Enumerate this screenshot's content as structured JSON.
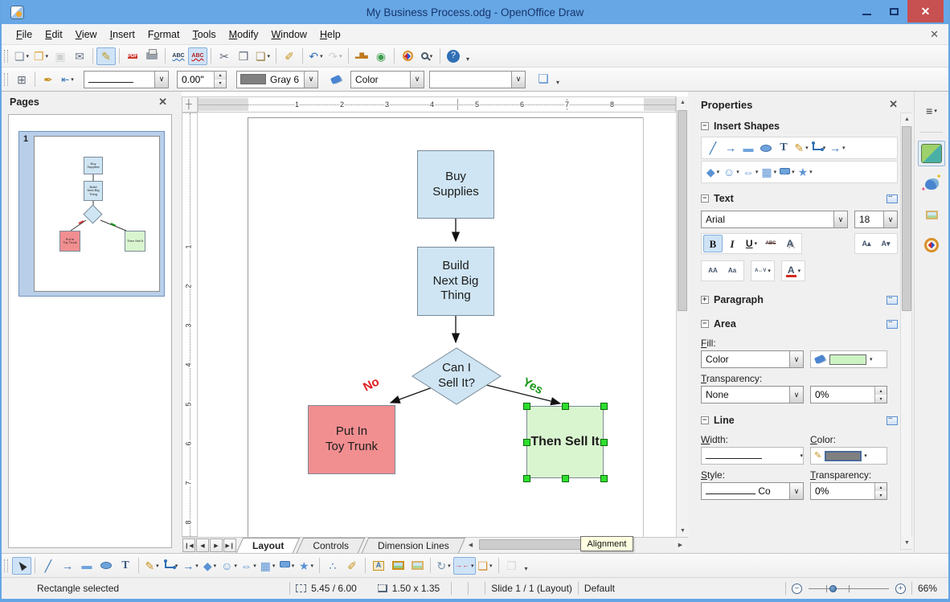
{
  "window": {
    "title": "My Business Process.odg - OpenOffice Draw"
  },
  "colors": {
    "titlebar": "#67a7e6",
    "close_button": "#c75050",
    "shape_blue": "#cfe5f3",
    "shape_red": "#f18e90",
    "shape_green": "#d9f5cf",
    "selection_handle": "#2ede2e",
    "no_label": "#e02020",
    "yes_label": "#169416",
    "line_gray": "#808080",
    "fill_green_swatch": "#cdf3c4"
  },
  "menu": {
    "items": [
      {
        "label": "File",
        "accel": 0
      },
      {
        "label": "Edit",
        "accel": 0
      },
      {
        "label": "View",
        "accel": 0
      },
      {
        "label": "Insert",
        "accel": 0
      },
      {
        "label": "Format",
        "accel": 1
      },
      {
        "label": "Tools",
        "accel": 0
      },
      {
        "label": "Modify",
        "accel": 0
      },
      {
        "label": "Window",
        "accel": 0
      },
      {
        "label": "Help",
        "accel": 0
      }
    ]
  },
  "toolbar_standard": {
    "items": [
      {
        "t": "grip"
      },
      {
        "n": "new-document-button",
        "g": "❏",
        "c": "#7d8ba0",
        "dd": true
      },
      {
        "n": "open-button",
        "g": "❐",
        "c": "#df9f3a",
        "dd": true
      },
      {
        "n": "save-button",
        "g": "▣",
        "c": "#8a97a8",
        "st": "disabled"
      },
      {
        "n": "email-button",
        "g": "✉",
        "c": "#6b7686"
      },
      {
        "t": "sep"
      },
      {
        "n": "edit-mode-button",
        "g": "✎",
        "c": "#c2991a",
        "st": "active"
      },
      {
        "t": "sep"
      },
      {
        "n": "export-pdf-button",
        "txt": "PDF",
        "bg": "#cf3a30",
        "c": "#ffffff",
        "fs": 6
      },
      {
        "n": "print-button",
        "cls": "g-printer"
      },
      {
        "t": "sep"
      },
      {
        "n": "spellcheck-button",
        "txt": "ABC",
        "c": "#2a3a55",
        "cls": "g-spell"
      },
      {
        "n": "autospellcheck-button",
        "txt": "ABC",
        "c": "#b02020",
        "cls": "g-spellauto",
        "st": "active"
      },
      {
        "t": "sep"
      },
      {
        "n": "cut-button",
        "g": "✂",
        "c": "#5f6b7a"
      },
      {
        "n": "copy-button",
        "g": "❒",
        "c": "#5f6b7a"
      },
      {
        "n": "paste-button",
        "g": "❏",
        "c": "#9a7c3f",
        "dd": true
      },
      {
        "t": "sep"
      },
      {
        "n": "clone-formatting-button",
        "g": "✐",
        "c": "#c8921b"
      },
      {
        "t": "sep"
      },
      {
        "n": "undo-button",
        "g": "↶",
        "c": "#2f6fb5",
        "dd": true
      },
      {
        "n": "redo-button",
        "g": "↷",
        "c": "#8a97a8",
        "st": "disabled",
        "dd": true
      },
      {
        "t": "sep"
      },
      {
        "n": "insert-chart-button",
        "txt": "▂▇▄",
        "c": "#bf7a1f",
        "fs": 7
      },
      {
        "n": "hyperlink-button",
        "g": "◉",
        "c": "#3f9e4f"
      },
      {
        "t": "sep"
      },
      {
        "n": "navigator-button",
        "cls": "g-compass-sm"
      },
      {
        "n": "zoom-button",
        "cls": "g-zoom",
        "dd": true
      },
      {
        "t": "sep"
      },
      {
        "n": "help-button",
        "g": "?",
        "bg": "#2f6fb5",
        "c": "#ffffff",
        "round": true,
        "fs": 11
      },
      {
        "t": "overflow"
      }
    ]
  },
  "toolbar_linefill": {
    "styles_button": "styles-window-button",
    "width_value": "0.00\"",
    "line_color_name": "Gray 6",
    "fill_type": "Color",
    "fill_color_value": ""
  },
  "pages_panel": {
    "title": "Pages",
    "page_number": "1"
  },
  "canvas": {
    "hruler_numbers": [
      "1",
      "2",
      "3",
      "4",
      "5",
      "6",
      "7",
      "8"
    ],
    "vruler_numbers": [
      "1",
      "2",
      "3",
      "4",
      "5",
      "6",
      "7",
      "8"
    ]
  },
  "flowchart": {
    "nodes": [
      {
        "id": "buy",
        "type": "process",
        "label": "Buy\nSupplies",
        "fill": "#cfe5f3"
      },
      {
        "id": "build",
        "type": "process",
        "label": "Build\nNext Big\nThing",
        "fill": "#cfe5f3"
      },
      {
        "id": "decide",
        "type": "decision",
        "label": "Can I\nSell It?",
        "fill": "#cfe5f3"
      },
      {
        "id": "trunk",
        "type": "process",
        "label": "Put In\nToy Trunk",
        "fill": "#f18e90"
      },
      {
        "id": "sell",
        "type": "process",
        "label": "Then Sell It",
        "fill": "#d9f5cf",
        "selected": true
      }
    ],
    "edges": [
      {
        "from": "decide",
        "to": "trunk",
        "label": "No",
        "color": "#e02020"
      },
      {
        "from": "decide",
        "to": "sell",
        "label": "Yes",
        "color": "#169416"
      }
    ]
  },
  "tabs": {
    "items": [
      {
        "label": "Layout",
        "active": true
      },
      {
        "label": "Controls",
        "active": false
      },
      {
        "label": "Dimension Lines",
        "active": false
      }
    ]
  },
  "tooltip": {
    "text": "Alignment"
  },
  "toolbar_drawing": {
    "items": [
      {
        "t": "grip"
      },
      {
        "n": "select-button",
        "cls": "g-cursor",
        "st": "active"
      },
      {
        "t": "sep"
      },
      {
        "n": "line-button",
        "g": "╱",
        "c": "#2f6fb5"
      },
      {
        "n": "arrow-button",
        "g": "→",
        "c": "#2f6fb5"
      },
      {
        "n": "rectangle-button",
        "g": "▬",
        "c": "#6fa3dc",
        "fs": 13
      },
      {
        "n": "ellipse-button",
        "cls": "g-ellipse"
      },
      {
        "n": "text-button",
        "txt": "T",
        "c": "#3a5a80",
        "cls": "g-serif"
      },
      {
        "t": "sep"
      },
      {
        "n": "curve-button",
        "g": "✎",
        "c": "#c8921b",
        "dd": true
      },
      {
        "n": "connector-button",
        "cls": "g-conn",
        "dd": true
      },
      {
        "n": "lines-arrows-button",
        "g": "→",
        "c": "#2f6fb5",
        "dd": true
      },
      {
        "n": "basic-shapes-button",
        "g": "◆",
        "c": "#5b93d4",
        "dd": true
      },
      {
        "n": "symbol-shapes-button",
        "g": "☺",
        "c": "#5b93d4",
        "dd": true
      },
      {
        "n": "block-arrows-button",
        "g": "⇔",
        "c": "#5b93d4",
        "dd": true
      },
      {
        "n": "flowchart-shapes-button",
        "g": "▦",
        "c": "#5b93d4",
        "dd": true
      },
      {
        "n": "callout-shapes-button",
        "cls": "g-callout",
        "dd": true
      },
      {
        "n": "star-shapes-button",
        "g": "★",
        "c": "#5b93d4",
        "dd": true
      },
      {
        "t": "sep"
      },
      {
        "n": "edit-points-button",
        "g": "∴",
        "c": "#2f6fb5"
      },
      {
        "n": "glue-points-button",
        "g": "✐",
        "c": "#c8921b"
      },
      {
        "t": "sep"
      },
      {
        "n": "fontwork-button",
        "cls": "g-fontwork",
        "txt": "A"
      },
      {
        "n": "insert-image-button",
        "cls": "g-pic"
      },
      {
        "n": "gallery-button",
        "cls": "g-pic2"
      },
      {
        "t": "sep"
      },
      {
        "n": "rotate-button",
        "g": "↻",
        "c": "#7a93ad",
        "dd": true
      },
      {
        "n": "alignment-button",
        "txt": "→←",
        "c": "#cc3333",
        "fs": 9,
        "st": "hover",
        "dd": true
      },
      {
        "n": "arrange-button",
        "g": "❑",
        "c": "#d98f2b",
        "dd": true
      },
      {
        "t": "sep"
      },
      {
        "n": "interaction-button",
        "g": "❒",
        "c": "#a9a9a9",
        "st": "disabled"
      },
      {
        "t": "overflow"
      }
    ]
  },
  "statusbar": {
    "selection": "Rectangle selected",
    "position": "5.45 / 6.00",
    "size": "1.50 x 1.35",
    "slide": "Slide 1 / 1 (Layout)",
    "style": "Default",
    "zoom": "66%"
  },
  "properties": {
    "title": "Properties",
    "sections": {
      "insert_shapes": "Insert Shapes",
      "text": "Text",
      "paragraph": "Paragraph",
      "area": "Area",
      "line": "Line"
    },
    "insert_shapes_row1": [
      {
        "n": "insert-line-button",
        "g": "╱",
        "c": "#2f6fb5"
      },
      {
        "n": "insert-arrow-button",
        "g": "→",
        "c": "#2f6fb5"
      },
      {
        "n": "insert-rectangle-button",
        "g": "▬",
        "c": "#6fa3dc",
        "fs": 13
      },
      {
        "n": "insert-ellipse-button",
        "cls": "g-ellipse"
      },
      {
        "n": "insert-text-button",
        "txt": "T",
        "c": "#3a5a80",
        "cls": "g-serif"
      },
      {
        "n": "insert-curve-button",
        "g": "✎",
        "c": "#c8921b",
        "dd": true
      },
      {
        "n": "insert-connector-button",
        "cls": "g-conn",
        "dd": true
      },
      {
        "n": "insert-lines-arrows-button",
        "g": "→",
        "c": "#2f6fb5",
        "dd": true
      }
    ],
    "insert_shapes_row2": [
      {
        "n": "basic-shapes-button",
        "g": "◆",
        "c": "#5b93d4",
        "dd": true
      },
      {
        "n": "symbol-shapes-button",
        "g": "☺",
        "c": "#5b93d4",
        "dd": true
      },
      {
        "n": "block-arrows-button",
        "g": "⇔",
        "c": "#5b93d4",
        "dd": true
      },
      {
        "n": "flowchart-shapes-button",
        "g": "▦",
        "c": "#5b93d4",
        "dd": true
      },
      {
        "n": "callout-shapes-button",
        "cls": "g-callout",
        "dd": true
      },
      {
        "n": "star-shapes-button",
        "g": "★",
        "c": "#5b93d4",
        "dd": true
      }
    ],
    "text_panel": {
      "font_name": "Arial",
      "font_size": "18",
      "fmt_row1": [
        {
          "n": "bold-button",
          "txt": "B",
          "c": "#1a1a1a",
          "fs": 13,
          "cls": "g-b",
          "st": "active"
        },
        {
          "n": "italic-button",
          "txt": "I",
          "c": "#1a1a1a",
          "fs": 13,
          "cls": "g-i"
        },
        {
          "n": "underline-button",
          "txt": "U",
          "c": "#1a1a1a",
          "fs": 12,
          "cls": "g-u",
          "dd": true
        },
        {
          "n": "strikethrough-button",
          "txt": "ABC",
          "cls": "g-strike"
        },
        {
          "n": "font-shadow-button",
          "txt": "A",
          "cls": "g-ashadow"
        }
      ],
      "fmt_row1b": [
        {
          "n": "increase-font-size-button",
          "txt": "A▴",
          "c": "#44546a",
          "fs": 9
        },
        {
          "n": "reduce-font-size-button",
          "txt": "A▾",
          "c": "#44546a",
          "fs": 9
        }
      ],
      "fmt_row2a": [
        {
          "n": "uppercase-button",
          "txt": "AA",
          "c": "#44546a",
          "fs": 8
        },
        {
          "n": "lowercase-button",
          "txt": "Aa",
          "c": "#44546a",
          "fs": 8
        }
      ],
      "fmt_row2b": [
        {
          "n": "character-spacing-button",
          "txt": "A↔V",
          "c": "#44546a",
          "fs": 6,
          "dd": true
        }
      ],
      "fmt_row2c": [
        {
          "n": "font-color-button",
          "cls": "g-fontcolor",
          "txt": "A",
          "dd": true
        }
      ]
    },
    "area_panel": {
      "fill_label": "Fill:",
      "fill_type": "Color",
      "transparency_label": "Transparency:",
      "transparency_type": "None",
      "transparency_value": "0%"
    },
    "line_panel": {
      "width_label": "Width:",
      "color_label": "Color:",
      "style_label": "Style:",
      "transparency_label": "Transparency:",
      "style_value": "Co",
      "transparency_value": "0%"
    }
  },
  "sidebar_rail": {
    "items": [
      {
        "n": "sidebar-menu-button",
        "g": "≡",
        "c": "#333333",
        "dd": true
      },
      {
        "t": "railsep"
      },
      {
        "n": "sidebar-tab-properties",
        "cls": "g-cube",
        "st": "active"
      },
      {
        "n": "sidebar-tab-effects",
        "cls": "g-gal"
      },
      {
        "n": "sidebar-tab-gallery",
        "cls": "g-pic2"
      },
      {
        "n": "sidebar-tab-navigator",
        "cls": "g-compass"
      }
    ]
  }
}
